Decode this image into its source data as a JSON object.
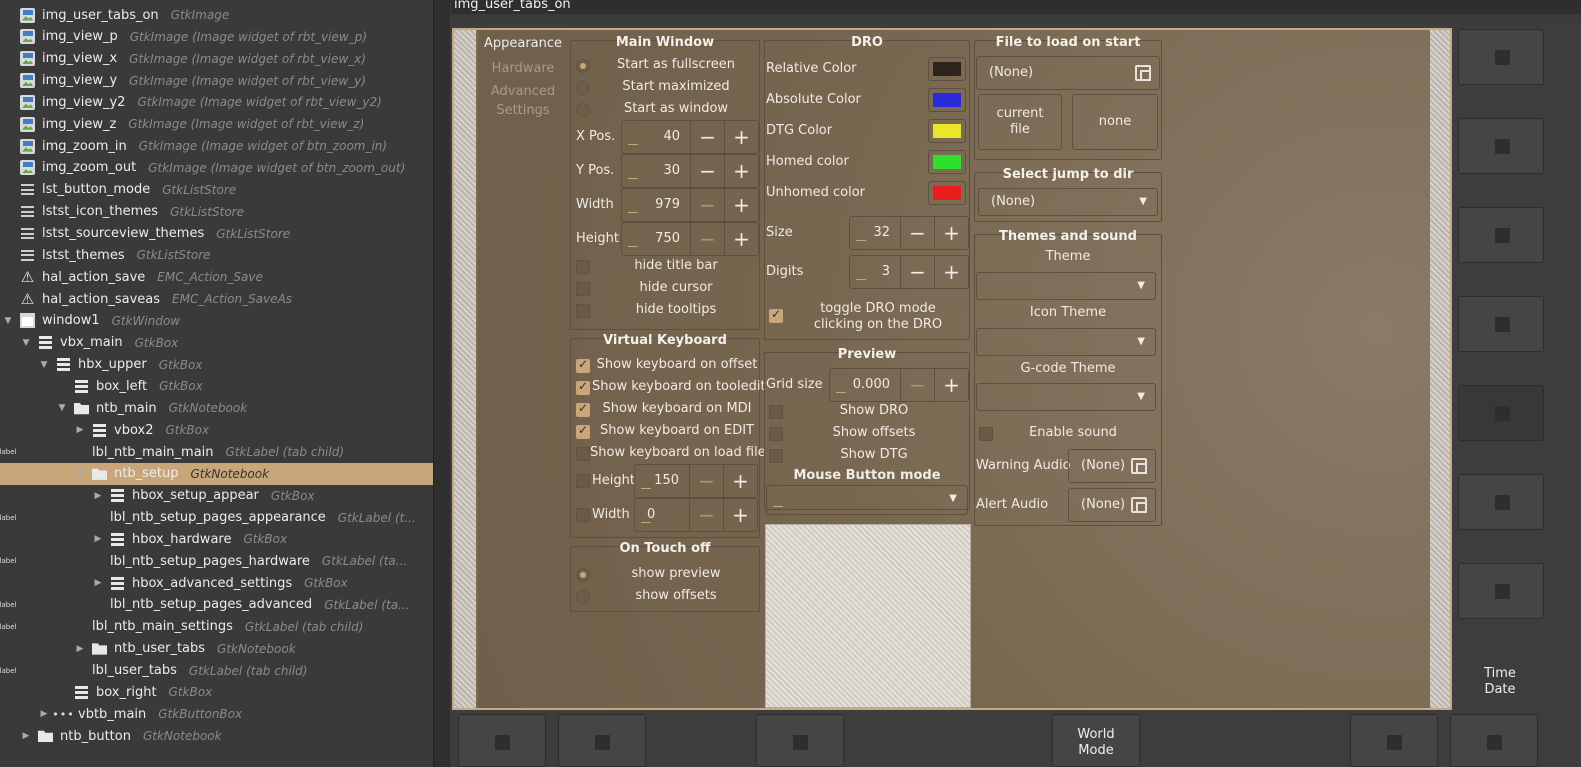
{
  "tree": [
    {
      "name": "img_user_tabs_on",
      "type": "GtkImage",
      "icon": "image-icon",
      "depth": 1
    },
    {
      "name": "img_view_p",
      "type": "GtkImage  (Image widget of rbt_view_p)",
      "icon": "image-icon",
      "depth": 1
    },
    {
      "name": "img_view_x",
      "type": "GtkImage  (Image widget of rbt_view_x)",
      "icon": "image-icon",
      "depth": 1
    },
    {
      "name": "img_view_y",
      "type": "GtkImage  (Image widget of rbt_view_y)",
      "icon": "image-icon",
      "depth": 1
    },
    {
      "name": "img_view_y2",
      "type": "GtkImage  (Image widget of rbt_view_y2)",
      "icon": "image-icon",
      "depth": 1
    },
    {
      "name": "img_view_z",
      "type": "GtkImage  (Image widget of rbt_view_z)",
      "icon": "image-icon",
      "depth": 1
    },
    {
      "name": "img_zoom_in",
      "type": "GtkImage  (Image widget of btn_zoom_in)",
      "icon": "image-icon",
      "depth": 1
    },
    {
      "name": "img_zoom_out",
      "type": "GtkImage  (Image widget of btn_zoom_out)",
      "icon": "image-icon",
      "depth": 1
    },
    {
      "name": "lst_button_mode",
      "type": "GtkListStore",
      "icon": "list-store-icon",
      "depth": 1
    },
    {
      "name": "lstst_icon_themes",
      "type": "GtkListStore",
      "icon": "list-store-icon",
      "depth": 1
    },
    {
      "name": "lstst_sourceview_themes",
      "type": "GtkListStore",
      "icon": "list-store-icon",
      "depth": 1
    },
    {
      "name": "lstst_themes",
      "type": "GtkListStore",
      "icon": "list-store-icon",
      "depth": 1
    },
    {
      "name": "hal_action_save",
      "type": "EMC_Action_Save",
      "icon": "warning-icon",
      "depth": 1
    },
    {
      "name": "hal_action_saveas",
      "type": "EMC_Action_SaveAs",
      "icon": "warning-icon",
      "depth": 1
    },
    {
      "name": "window1",
      "type": "GtkWindow",
      "icon": "window-icon",
      "depth": 1,
      "expander": "open"
    },
    {
      "name": "vbx_main",
      "type": "GtkBox",
      "icon": "box-icon",
      "depth": 2,
      "expander": "open"
    },
    {
      "name": "hbx_upper",
      "type": "GtkBox",
      "icon": "box-icon",
      "depth": 3,
      "expander": "open"
    },
    {
      "name": "box_left",
      "type": "GtkBox",
      "icon": "box-icon",
      "depth": 4
    },
    {
      "name": "ntb_main",
      "type": "GtkNotebook",
      "icon": "folder-icon",
      "depth": 4,
      "expander": "open"
    },
    {
      "name": "vbox2",
      "type": "GtkBox",
      "icon": "box-icon",
      "depth": 5,
      "expander": "closed"
    },
    {
      "name": "lbl_ntb_main_main",
      "type": "GtkLabel  (tab child)",
      "icon": "label-icon",
      "depth": 5
    },
    {
      "name": "ntb_setup",
      "type": "GtkNotebook",
      "icon": "folder-icon",
      "depth": 5,
      "expander": "open",
      "selected": true
    },
    {
      "name": "hbox_setup_appear",
      "type": "GtkBox",
      "icon": "box-icon",
      "depth": 6,
      "expander": "closed"
    },
    {
      "name": "lbl_ntb_setup_pages_appearance",
      "type": "GtkLabel  (t...",
      "icon": "label-icon",
      "depth": 6
    },
    {
      "name": "hbox_hardware",
      "type": "GtkBox",
      "icon": "box-icon",
      "depth": 6,
      "expander": "closed"
    },
    {
      "name": "lbl_ntb_setup_pages_hardware",
      "type": "GtkLabel  (ta...",
      "icon": "label-icon",
      "depth": 6
    },
    {
      "name": "hbox_advanced_settings",
      "type": "GtkBox",
      "icon": "box-icon",
      "depth": 6,
      "expander": "closed"
    },
    {
      "name": "lbl_ntb_setup_pages_advanced",
      "type": "GtkLabel  (ta...",
      "icon": "label-icon",
      "depth": 6
    },
    {
      "name": "lbl_ntb_main_settings",
      "type": "GtkLabel  (tab child)",
      "icon": "label-icon",
      "depth": 5
    },
    {
      "name": "ntb_user_tabs",
      "type": "GtkNotebook",
      "icon": "folder-icon",
      "depth": 5,
      "expander": "closed"
    },
    {
      "name": "lbl_user_tabs",
      "type": "GtkLabel  (tab child)",
      "icon": "label-icon",
      "depth": 5
    },
    {
      "name": "box_right",
      "type": "GtkBox",
      "icon": "box-icon",
      "depth": 4
    },
    {
      "name": "vbtb_main",
      "type": "GtkButtonBox",
      "icon": "dots-icon",
      "depth": 3,
      "expander": "closed"
    },
    {
      "name": "ntb_button",
      "type": "GtkNotebook",
      "icon": "folder-icon",
      "depth": 2,
      "expander": "closed"
    }
  ],
  "canvas_title": "img_user_tabs_on",
  "tabs": [
    "Appearance",
    "Hardware",
    "Advanced\nSettings"
  ],
  "main_window": {
    "title": "Main Window",
    "radios": [
      {
        "label": "Start as fullscreen",
        "on": true
      },
      {
        "label": "Start maximized",
        "on": false
      },
      {
        "label": "Start as window",
        "on": false
      }
    ],
    "x_label": "X Pos.",
    "x_val": "40",
    "y_label": "Y Pos.",
    "y_val": "30",
    "w_label": "Width",
    "w_val": "979",
    "h_label": "Height",
    "h_val": "750",
    "checks": [
      "hide title bar",
      "hide cursor",
      "hide tooltips"
    ]
  },
  "virtual_keyboard": {
    "title": "Virtual Keyboard",
    "checks": [
      {
        "label": "Show keyboard on offset",
        "on": true
      },
      {
        "label": "Show keyboard on tooledit",
        "on": true
      },
      {
        "label": "Show keyboard on MDI",
        "on": true
      },
      {
        "label": "Show keyboard on EDIT",
        "on": true
      },
      {
        "label": "Show keyboard on load file",
        "on": false
      }
    ],
    "h_label": "Height",
    "h_val": "150",
    "w_label": "Width",
    "w_val": "0"
  },
  "on_touch_off": {
    "title": "On Touch off",
    "radios": [
      {
        "label": "show preview",
        "on": true
      },
      {
        "label": "show offsets",
        "on": false
      }
    ]
  },
  "dro": {
    "title": "DRO",
    "colors": [
      {
        "label": "Relative Color",
        "color": "#2b231c"
      },
      {
        "label": "Absolute Color",
        "color": "#2a2ad8"
      },
      {
        "label": "DTG Color",
        "color": "#ece628"
      },
      {
        "label": "Homed color",
        "color": "#2ee02e"
      },
      {
        "label": "Unhomed color",
        "color": "#ea1d1d"
      }
    ],
    "size_label": "Size",
    "size_val": "32",
    "digits_label": "Digits",
    "digits_val": "3",
    "toggle_label": "toggle DRO mode\nclicking on the DRO"
  },
  "preview": {
    "title": "Preview",
    "grid_label": "Grid size",
    "grid_val": "0.000",
    "checks": [
      "Show DRO",
      "Show offsets",
      "Show DTG"
    ],
    "mouse_title": "Mouse Button mode"
  },
  "file_load": {
    "title": "File to load on start",
    "value": "(None)",
    "btn_current": "current\nfile",
    "btn_none": "none"
  },
  "jump_dir": {
    "title": "Select jump to dir",
    "value": "(None)"
  },
  "themes": {
    "title": "Themes and sound",
    "theme_label": "Theme",
    "icon_label": "Icon Theme",
    "gcode_label": "G-code Theme",
    "sound_label": "Enable sound",
    "warning_label": "Warning Audio",
    "warning_val": "(None)",
    "alert_label": "Alert Audio",
    "alert_val": "(None)"
  },
  "right_panel": {
    "time_date": "Time\nDate"
  },
  "bottom": {
    "world_mode": "World\nMode"
  }
}
